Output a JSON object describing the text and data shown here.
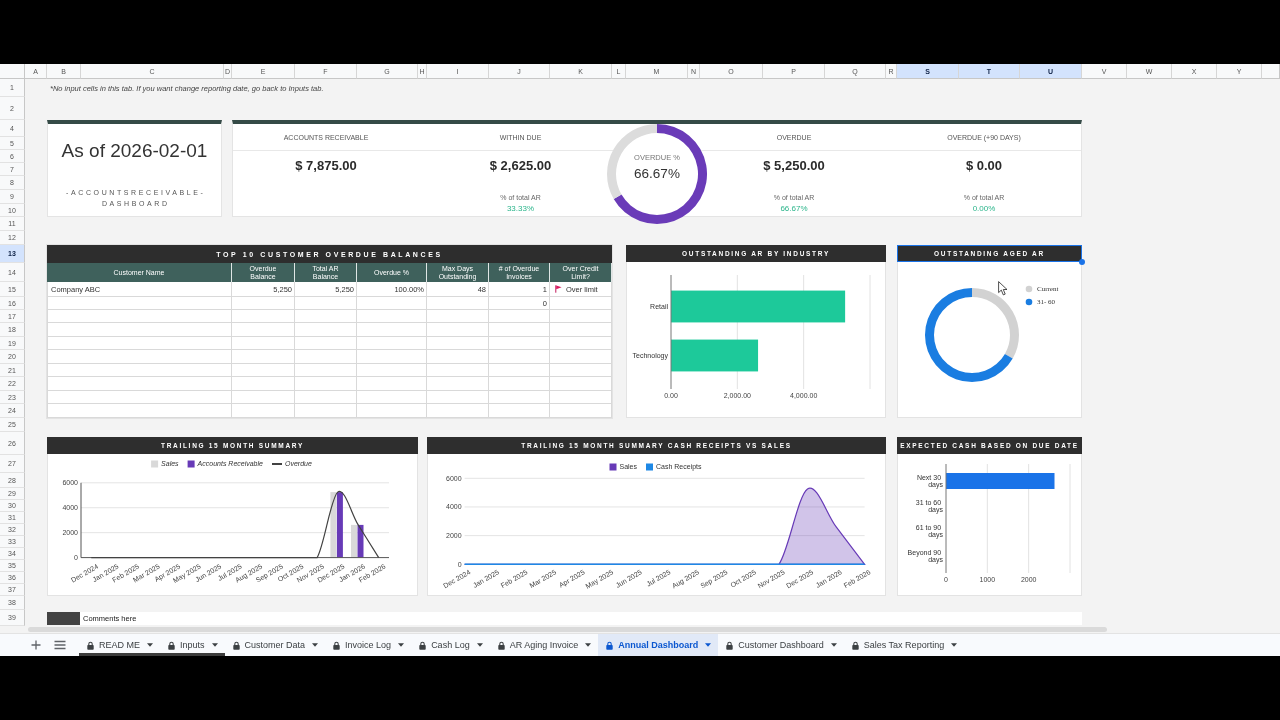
{
  "sheet": {
    "columns": [
      {
        "label": "A",
        "selected": false
      },
      {
        "label": "B",
        "selected": false
      },
      {
        "label": "C",
        "selected": false
      },
      {
        "label": "D",
        "selected": false
      },
      {
        "label": "E",
        "selected": false
      },
      {
        "label": "F",
        "selected": false
      },
      {
        "label": "G",
        "selected": false
      },
      {
        "label": "H",
        "selected": false
      },
      {
        "label": "I",
        "selected": false
      },
      {
        "label": "J",
        "selected": false
      },
      {
        "label": "K",
        "selected": false
      },
      {
        "label": "L",
        "selected": false
      },
      {
        "label": "M",
        "selected": false
      },
      {
        "label": "N",
        "selected": false
      },
      {
        "label": "O",
        "selected": false
      },
      {
        "label": "P",
        "selected": false
      },
      {
        "label": "Q",
        "selected": false
      },
      {
        "label": "R",
        "selected": false
      },
      {
        "label": "S",
        "selected": true
      },
      {
        "label": "T",
        "selected": true
      },
      {
        "label": "U",
        "selected": true
      },
      {
        "label": "V",
        "selected": false
      },
      {
        "label": "W",
        "selected": false
      },
      {
        "label": "X",
        "selected": false
      },
      {
        "label": "Y",
        "selected": false
      }
    ],
    "rows": [
      {
        "label": "1",
        "selected": false
      },
      {
        "label": "2",
        "selected": false
      },
      {
        "label": "4",
        "selected": false
      },
      {
        "label": "5",
        "selected": false
      },
      {
        "label": "6",
        "selected": false
      },
      {
        "label": "7",
        "selected": false
      },
      {
        "label": "8",
        "selected": false
      },
      {
        "label": "9",
        "selected": false
      },
      {
        "label": "10",
        "selected": false
      },
      {
        "label": "11",
        "selected": false
      },
      {
        "label": "12",
        "selected": false
      },
      {
        "label": "13",
        "selected": true
      },
      {
        "label": "14",
        "selected": false
      },
      {
        "label": "15",
        "selected": false
      },
      {
        "label": "16",
        "selected": false
      },
      {
        "label": "17",
        "selected": false
      },
      {
        "label": "18",
        "selected": false
      },
      {
        "label": "19",
        "selected": false
      },
      {
        "label": "20",
        "selected": false
      },
      {
        "label": "21",
        "selected": false
      },
      {
        "label": "22",
        "selected": false
      },
      {
        "label": "23",
        "selected": false
      },
      {
        "label": "24",
        "selected": false
      },
      {
        "label": "25",
        "selected": false
      },
      {
        "label": "26",
        "selected": false
      },
      {
        "label": "27",
        "selected": false
      },
      {
        "label": "28",
        "selected": false
      },
      {
        "label": "29",
        "selected": false
      },
      {
        "label": "30",
        "selected": false
      },
      {
        "label": "31",
        "selected": false
      },
      {
        "label": "32",
        "selected": false
      },
      {
        "label": "33",
        "selected": false
      },
      {
        "label": "34",
        "selected": false
      },
      {
        "label": "35",
        "selected": false
      },
      {
        "label": "36",
        "selected": false
      },
      {
        "label": "37",
        "selected": false
      },
      {
        "label": "38",
        "selected": false
      },
      {
        "label": "39",
        "selected": false
      }
    ],
    "note": "*No input cells in this tab. If you want change reporting date, go back to Inputs tab."
  },
  "title_card": {
    "title": "As of 2026-02-01",
    "subtitle": "-ACCOUNTSRECEIVABLE- DASHBOARD"
  },
  "kpis": [
    {
      "kind": "metric",
      "label": "ACCOUNTS RECEIVABLE",
      "value": "$ 7,875.00"
    },
    {
      "kind": "metric",
      "label": "WITHIN DUE",
      "value": "$ 2,625.00",
      "share_label": "% of total AR",
      "share": "33.33%"
    },
    {
      "kind": "gauge",
      "label": "OVERDUE %",
      "value": "66.67%",
      "chart_data": {
        "type": "donut",
        "values": [
          66.67,
          33.33
        ],
        "colors": [
          "#6a3bb8",
          "#dcdcdc"
        ]
      }
    },
    {
      "kind": "metric",
      "label": "OVERDUE",
      "value": "$ 5,250.00",
      "share_label": "% of total AR",
      "share": "66.67%"
    },
    {
      "kind": "metric",
      "label": "OVERDUE (+90 DAYS)",
      "value": "$ 0.00",
      "share_label": "% of total AR",
      "share": "0.00%"
    }
  ],
  "top_customers": {
    "title": "TOP 10 CUSTOMER OVERDUE BALANCES",
    "columns": [
      "Customer Name",
      "Overdue Balance",
      "Total AR Balance",
      "Overdue %",
      "Max Days Outstanding",
      "# of Overdue Invoices",
      "Over Credit Limit?"
    ],
    "rows": [
      {
        "cells": [
          "Company ABC",
          "5,250",
          "5,250",
          "100.00%",
          "48",
          "1",
          "Over limit"
        ],
        "over_limit_flag": true
      },
      {
        "cells": [
          null,
          null,
          null,
          null,
          null,
          "0",
          null
        ],
        "over_limit_flag": false
      }
    ]
  },
  "industry_panel": {
    "selected": false,
    "chart_data": {
      "type": "bar",
      "orientation": "horizontal",
      "title": "OUTSTANDING AR BY INDUSTRY",
      "categories": [
        "Retail",
        "Technology"
      ],
      "values": [
        5250,
        2625
      ],
      "color": "#1dc99a",
      "xlim": [
        0,
        6000
      ],
      "xticks": [
        {
          "value": 0,
          "label": "0.00"
        },
        {
          "value": 2000,
          "label": "2,000.00"
        },
        {
          "value": 4000,
          "label": "4,000.00"
        }
      ],
      "grid": true
    }
  },
  "aged_ar_panel": {
    "selected": true,
    "chart_data": {
      "type": "donut",
      "title": "OUTSTANDING AGED AR",
      "categories": [
        "Current",
        "31- 60"
      ],
      "values": [
        33.33,
        66.67
      ],
      "colors": [
        "#d2d2d2",
        "#1a7de1"
      ],
      "legend": "right"
    }
  },
  "trailing_panel": {
    "selected": false,
    "chart_data": {
      "type": "bar",
      "title": "TRAILING 15 MONTH SUMMARY",
      "categories": [
        "Dec 2024",
        "Jan 2025",
        "Feb 2025",
        "Mar 2025",
        "Apr 2025",
        "May 2025",
        "Jun 2025",
        "Jul 2025",
        "Aug 2025",
        "Sep 2025",
        "Oct 2025",
        "Nov 2025",
        "Dec 2025",
        "Jan 2026",
        "Feb 2026"
      ],
      "series": [
        {
          "name": "Sales",
          "color": "#d9d9d9",
          "values": [
            0,
            0,
            0,
            0,
            0,
            0,
            0,
            0,
            0,
            0,
            0,
            0,
            5250,
            2625,
            0
          ]
        },
        {
          "name": "Accounts Receivable",
          "color": "#673ab7",
          "values": [
            0,
            0,
            0,
            0,
            0,
            0,
            0,
            0,
            0,
            0,
            0,
            0,
            5250,
            2625,
            0
          ]
        },
        {
          "name": "Overdue",
          "type": "line",
          "color": "#424242",
          "values": [
            0,
            0,
            0,
            0,
            0,
            0,
            0,
            0,
            0,
            0,
            0,
            0,
            5250,
            2625,
            0
          ]
        }
      ],
      "ylim": [
        0,
        6000
      ],
      "yticks": [
        0,
        2000,
        4000,
        6000
      ],
      "legend": "top",
      "grid": true
    }
  },
  "cash_panel": {
    "selected": false,
    "chart_data": {
      "type": "area",
      "title": "TRAILING 15 MONTH SUMMARY CASH RECEIPTS VS SALES",
      "categories": [
        "Dec 2024",
        "Jan 2025",
        "Feb 2025",
        "Mar 2025",
        "Apr 2025",
        "May 2025",
        "Jun 2025",
        "Jul 2025",
        "Aug 2025",
        "Sep 2025",
        "Oct 2025",
        "Nov 2025",
        "Dec 2025",
        "Jan 2026",
        "Feb 2026"
      ],
      "series": [
        {
          "name": "Sales",
          "color": "#673ab7",
          "values": [
            0,
            0,
            0,
            0,
            0,
            0,
            0,
            0,
            0,
            0,
            0,
            0,
            5250,
            2625,
            0
          ]
        },
        {
          "name": "Cash Receipts",
          "type": "line",
          "color": "#1e88e5",
          "values": [
            0,
            0,
            0,
            0,
            0,
            0,
            0,
            0,
            0,
            0,
            0,
            0,
            0,
            0,
            0
          ]
        }
      ],
      "ylim": [
        0,
        6000
      ],
      "yticks": [
        0,
        2000,
        4000,
        6000
      ],
      "legend": "top",
      "grid": true
    }
  },
  "expected_cash_panel": {
    "selected": false,
    "chart_data": {
      "type": "bar",
      "orientation": "horizontal",
      "title": "EXPECTED CASH BASED ON DUE DATE",
      "categories": [
        "Next 30 days",
        "31 to 60 days",
        "61 to 90 days",
        "Beyond 90 days"
      ],
      "values": [
        2625,
        0,
        0,
        0
      ],
      "color": "#1a73e8",
      "xlim": [
        0,
        3000
      ],
      "xticks": [
        0,
        1000,
        2000
      ],
      "grid": true
    }
  },
  "comments": {
    "label": "Comments here"
  },
  "sheet_tabs": [
    {
      "label": "READ ME",
      "locked": true,
      "selected": false,
      "color": "#3c3c3c"
    },
    {
      "label": "Inputs",
      "locked": true,
      "selected": false,
      "color": "#3c3c3c"
    },
    {
      "label": "Customer Data",
      "locked": true,
      "selected": false
    },
    {
      "label": "Invoice Log",
      "locked": true,
      "selected": false
    },
    {
      "label": "Cash Log",
      "locked": true,
      "selected": false
    },
    {
      "label": "AR Aging Invoice",
      "locked": true,
      "selected": false
    },
    {
      "label": "Annual Dashboard",
      "locked": true,
      "selected": true
    },
    {
      "label": "Customer Dashboard",
      "locked": true,
      "selected": false
    },
    {
      "label": "Sales Tax Reporting",
      "locked": true,
      "selected": false
    }
  ]
}
